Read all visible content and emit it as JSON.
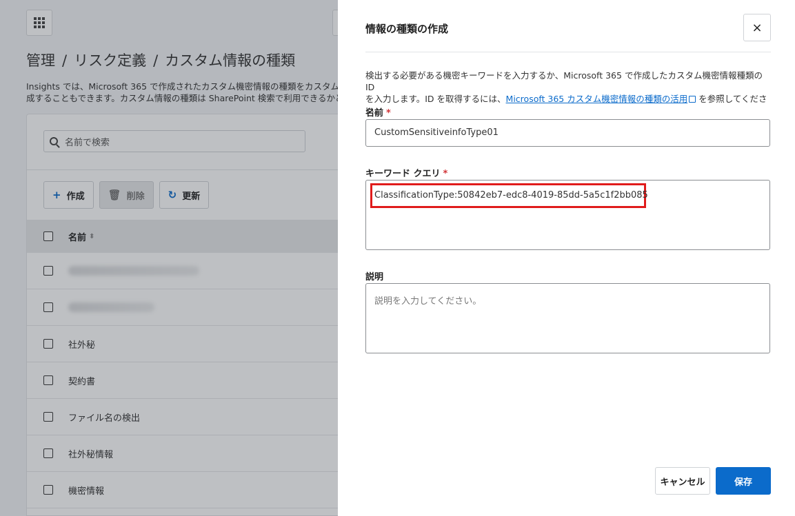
{
  "background": {
    "breadcrumb": [
      "管理",
      "リスク定義",
      "カスタム情報の種類"
    ],
    "breadcrumb_sep": "/",
    "intro_line1": "Insights では、Microsoft 365 で作成されたカスタム機密情報の種類をカスタム情",
    "intro_line2": "成することもできます。カスタム情報の種類は SharePoint 検索で利用できるかどうか",
    "search_placeholder": "名前で検索",
    "toolbar": {
      "create": "作成",
      "delete": "削除",
      "refresh": "更新"
    },
    "table": {
      "header_name": "名前",
      "rows": [
        "",
        "",
        "社外秘",
        "契約書",
        "ファイル名の検出",
        "社外秘情報",
        "機密情報"
      ]
    }
  },
  "panel": {
    "title": "情報の種類の作成",
    "close": "×",
    "description_line1": "検出する必要がある機密キーワードを入力するか、Microsoft 365 で作成したカスタム機密情報種類の ID",
    "description_line2_pre": "を入力します。ID を取得するには、",
    "description_link": "Microsoft 365 カスタム機密情報の種類の活用",
    "description_line2_post": "を参照してください。",
    "name_label": "名前",
    "name_value": "CustomSensitiveinfoType01",
    "query_label": "キーワード クエリ",
    "query_value": "ClassificationType:50842eb7-edc8-4019-85dd-5a5c1f2bb085",
    "notes_label": "説明",
    "notes_placeholder": "説明を入力してください。",
    "required_mark": "*",
    "cancel": "キャンセル",
    "save": "保存"
  }
}
